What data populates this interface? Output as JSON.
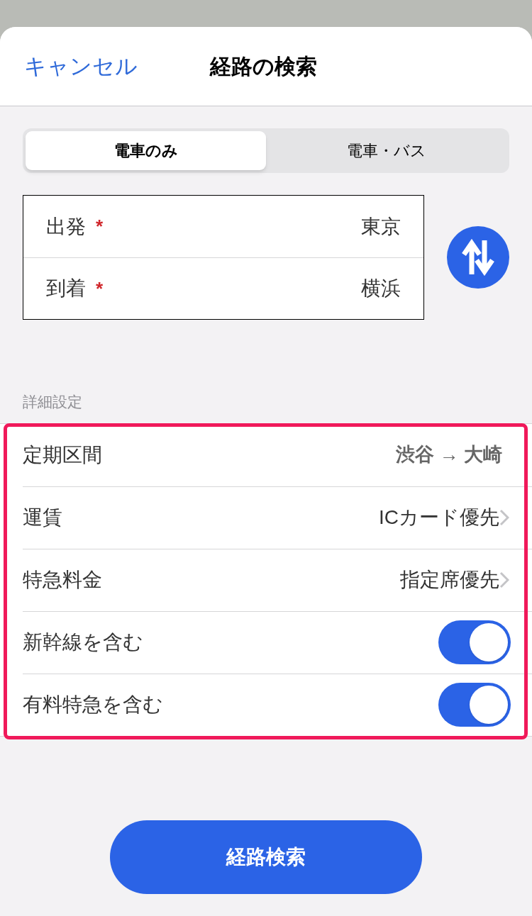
{
  "header": {
    "cancel": "キャンセル",
    "title": "経路の検索"
  },
  "segments": [
    {
      "label": "電車のみ",
      "selected": true
    },
    {
      "label": "電車・バス",
      "selected": false
    }
  ],
  "stations": [
    {
      "label": "出発",
      "required": true,
      "value": "東京"
    },
    {
      "label": "到着",
      "required": true,
      "value": "横浜"
    }
  ],
  "required_mark": "*",
  "section_title": "詳細設定",
  "settings": [
    {
      "kind": "value",
      "label": "定期区間",
      "value": "渋谷 → 大崎"
    },
    {
      "kind": "link",
      "label": "運賃",
      "value": "ICカード優先"
    },
    {
      "kind": "link",
      "label": "特急料金",
      "value": "指定席優先"
    },
    {
      "kind": "toggle",
      "label": "新幹線を含む",
      "on": true
    },
    {
      "kind": "toggle",
      "label": "有料特急を含む",
      "on": true
    }
  ],
  "search_button": "経路検索"
}
